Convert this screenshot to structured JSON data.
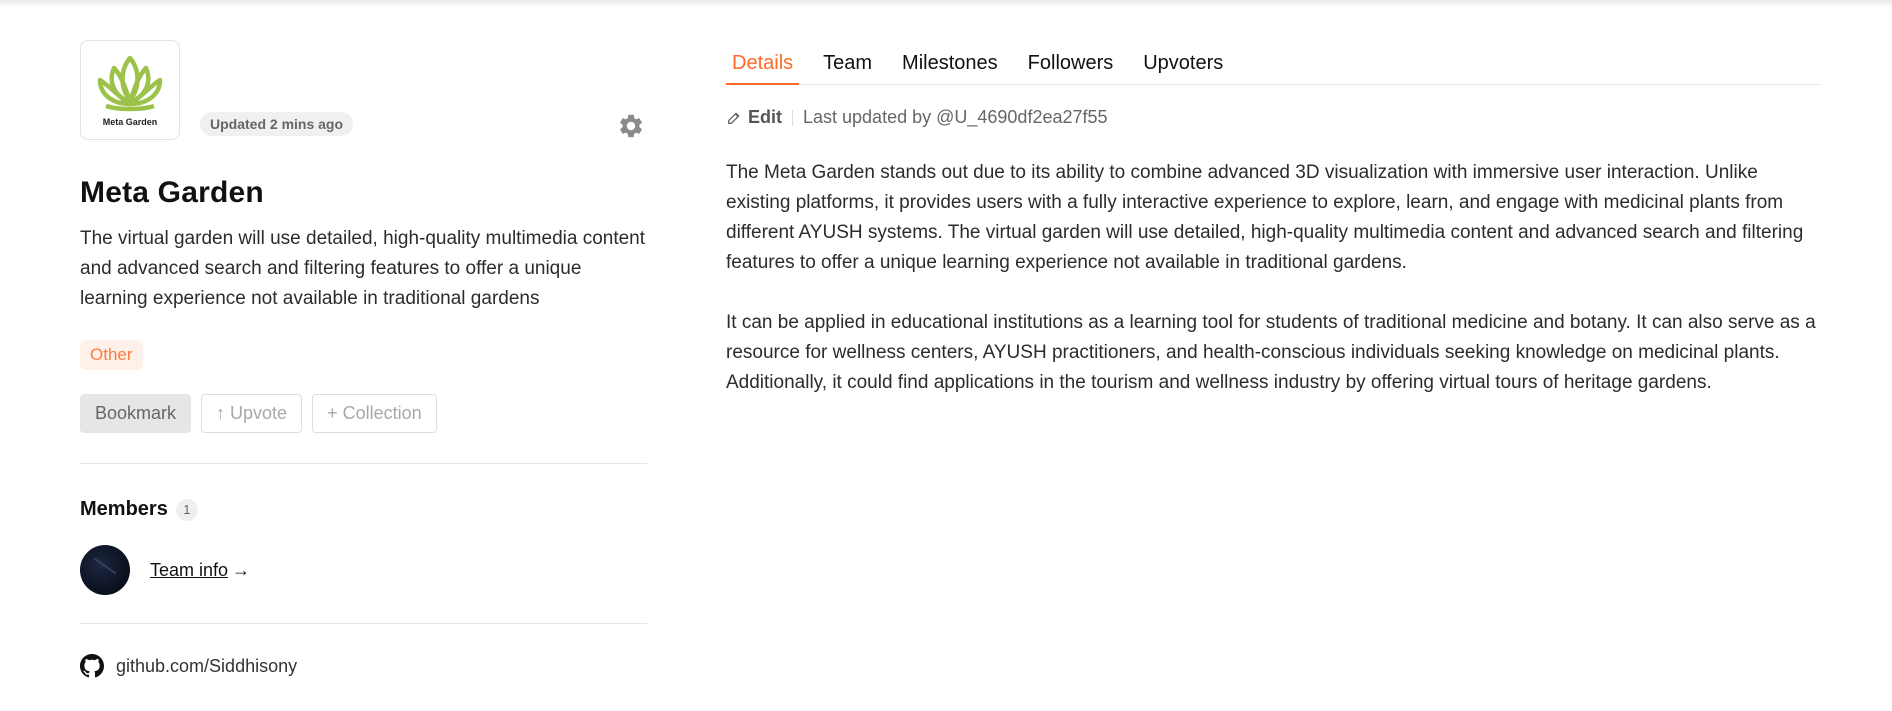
{
  "project": {
    "logo_text": "Meta Garden",
    "updated": "Updated 2 mins ago",
    "title": "Meta Garden",
    "description": "The virtual garden will use detailed, high-quality multimedia content and advanced search and filtering features to offer a unique learning experience not available in traditional gardens",
    "tag": "Other"
  },
  "actions": {
    "bookmark": "Bookmark",
    "upvote": "↑ Upvote",
    "collection": "+ Collection"
  },
  "members": {
    "title": "Members",
    "count": "1",
    "team_link": "Team info",
    "arrow": "→"
  },
  "github": {
    "text": "github.com/Siddhisony"
  },
  "tabs": [
    {
      "label": "Details",
      "active": true
    },
    {
      "label": "Team"
    },
    {
      "label": "Milestones"
    },
    {
      "label": "Followers"
    },
    {
      "label": "Upvoters"
    }
  ],
  "details": {
    "edit_label": "Edit",
    "last_updated": "Last updated by @U_4690df2ea27f55",
    "paragraphs": [
      "The Meta Garden stands out due to its ability to combine advanced 3D visualization with immersive user interaction. Unlike existing platforms, it provides users with a fully interactive experience to explore, learn, and engage with medicinal plants from different AYUSH systems. The virtual garden will use detailed, high-quality multimedia content and advanced search and filtering features to offer a unique learning experience not available in traditional gardens.",
      "It can be applied in educational institutions as a learning tool for students of traditional medicine and botany. It can also serve as a resource for wellness centers, AYUSH practitioners, and health-conscious individuals seeking knowledge on medicinal plants. Additionally, it could find applications in the tourism and wellness industry by offering virtual tours of heritage gardens."
    ]
  },
  "colors": {
    "accent": "#ff6a2b",
    "tag_bg": "#fff1ea",
    "logo_green": "#9cc24a"
  },
  "icons": {
    "settings": "gear-icon",
    "edit": "pencil-icon",
    "github": "github-icon",
    "logo": "lotus-icon"
  }
}
